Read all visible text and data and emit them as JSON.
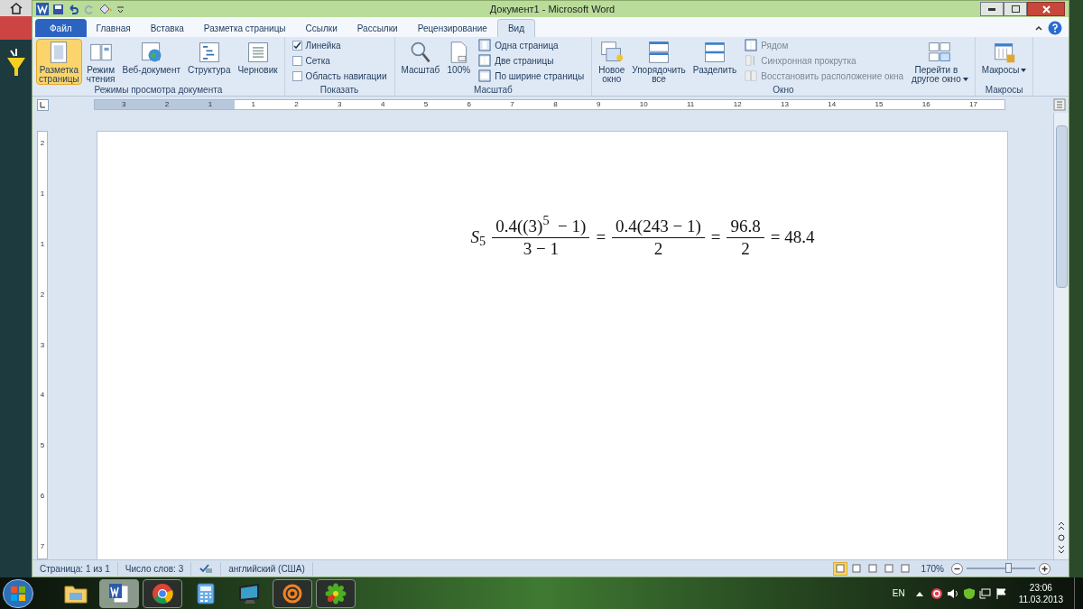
{
  "window": {
    "title": "Документ1 - Microsoft Word"
  },
  "tabs": [
    {
      "label": "Файл",
      "kind": "file",
      "selected": false
    },
    {
      "label": "Главная",
      "kind": "tab",
      "selected": false
    },
    {
      "label": "Вставка",
      "kind": "tab",
      "selected": false
    },
    {
      "label": "Разметка страницы",
      "kind": "tab",
      "selected": false
    },
    {
      "label": "Ссылки",
      "kind": "tab",
      "selected": false
    },
    {
      "label": "Рассылки",
      "kind": "tab",
      "selected": false
    },
    {
      "label": "Рецензирование",
      "kind": "tab",
      "selected": false
    },
    {
      "label": "Вид",
      "kind": "tab",
      "selected": true
    }
  ],
  "ribbon_groups": [
    {
      "label": "Режимы просмотра документа",
      "items": [
        {
          "kind": "large",
          "label": "Разметка\nстраницы",
          "selected": true,
          "has_menu": false
        },
        {
          "kind": "large",
          "label": "Режим\nчтения",
          "selected": false,
          "has_menu": false
        },
        {
          "kind": "large",
          "label": "Веб-документ",
          "selected": false,
          "has_menu": false
        },
        {
          "kind": "large",
          "label": "Структура",
          "selected": false,
          "has_menu": false
        },
        {
          "kind": "large",
          "label": "Черновик",
          "selected": false,
          "has_menu": false
        }
      ]
    },
    {
      "label": "Показать",
      "items": [
        {
          "kind": "checkbox",
          "label": "Линейка",
          "checked": true
        },
        {
          "kind": "checkbox",
          "label": "Сетка",
          "checked": false
        },
        {
          "kind": "checkbox",
          "label": "Область навигации",
          "checked": false
        }
      ]
    },
    {
      "label": "Масштаб",
      "items": [
        {
          "kind": "large",
          "label": "Масштаб",
          "selected": false,
          "has_menu": false
        },
        {
          "kind": "large",
          "label": "100%",
          "selected": false,
          "has_menu": false
        },
        {
          "kind": "small",
          "label": "Одна страница",
          "disabled": false
        },
        {
          "kind": "small",
          "label": "Две страницы",
          "disabled": false
        },
        {
          "kind": "small",
          "label": "По ширине страницы",
          "disabled": false
        }
      ]
    },
    {
      "label": "Окно",
      "items": [
        {
          "kind": "large",
          "label": "Новое\nокно",
          "selected": false,
          "has_menu": false
        },
        {
          "kind": "large",
          "label": "Упорядочить\nвсе",
          "selected": false,
          "has_menu": false
        },
        {
          "kind": "large",
          "label": "Разделить",
          "selected": false,
          "has_menu": false
        },
        {
          "kind": "small",
          "label": "Рядом",
          "disabled": true
        },
        {
          "kind": "small",
          "label": "Синхронная прокрутка",
          "disabled": true
        },
        {
          "kind": "small",
          "label": "Восстановить расположение окна",
          "disabled": true
        },
        {
          "kind": "large",
          "label": "Перейти в\nдругое окно",
          "selected": false,
          "has_menu": true
        }
      ]
    },
    {
      "label": "Макросы",
      "items": [
        {
          "kind": "large",
          "label": "Макросы",
          "selected": false,
          "has_menu": true
        }
      ]
    }
  ],
  "ruler": {
    "horizontal": [
      "3",
      "2",
      "1",
      "1",
      "2",
      "3",
      "4",
      "5",
      "6",
      "7",
      "8",
      "9",
      "10",
      "11",
      "12",
      "13",
      "14",
      "15",
      "16",
      "17"
    ],
    "vertical": [
      "2",
      "1",
      "1",
      "2",
      "3",
      "4",
      "5",
      "6",
      "7"
    ]
  },
  "equation": [
    {
      "kind": "text",
      "text": "*S*$_{5}$"
    },
    {
      "kind": "fraction",
      "numerator": "0.4((3)$^{5}$  − 1)",
      "denominator": "3 − 1"
    },
    {
      "kind": "text",
      "text": "="
    },
    {
      "kind": "fraction",
      "numerator": "0.4(243 − 1)",
      "denominator": "2"
    },
    {
      "kind": "text",
      "text": "="
    },
    {
      "kind": "fraction",
      "numerator": "96.8",
      "denominator": "2"
    },
    {
      "kind": "text",
      "text": "= 48.4"
    }
  ],
  "status_bar": {
    "page": "Страница: 1 из 1",
    "words": "Число слов: 3",
    "language": "английский (США)",
    "views": [
      {
        "selected": true
      },
      {
        "selected": false
      },
      {
        "selected": false
      },
      {
        "selected": false
      },
      {
        "selected": false
      }
    ],
    "zoom": "170%",
    "zoom_slider": {
      "level": 0.62
    }
  },
  "taskbar": {
    "apps": [
      {
        "selected": false,
        "running": false
      },
      {
        "selected": true,
        "running": true
      },
      {
        "selected": false,
        "running": true
      },
      {
        "selected": false,
        "running": false
      },
      {
        "selected": false,
        "running": false
      },
      {
        "selected": false,
        "running": true
      },
      {
        "selected": false,
        "running": true
      }
    ],
    "language": "EN",
    "time": "23:06",
    "date": "11.03.2013"
  }
}
